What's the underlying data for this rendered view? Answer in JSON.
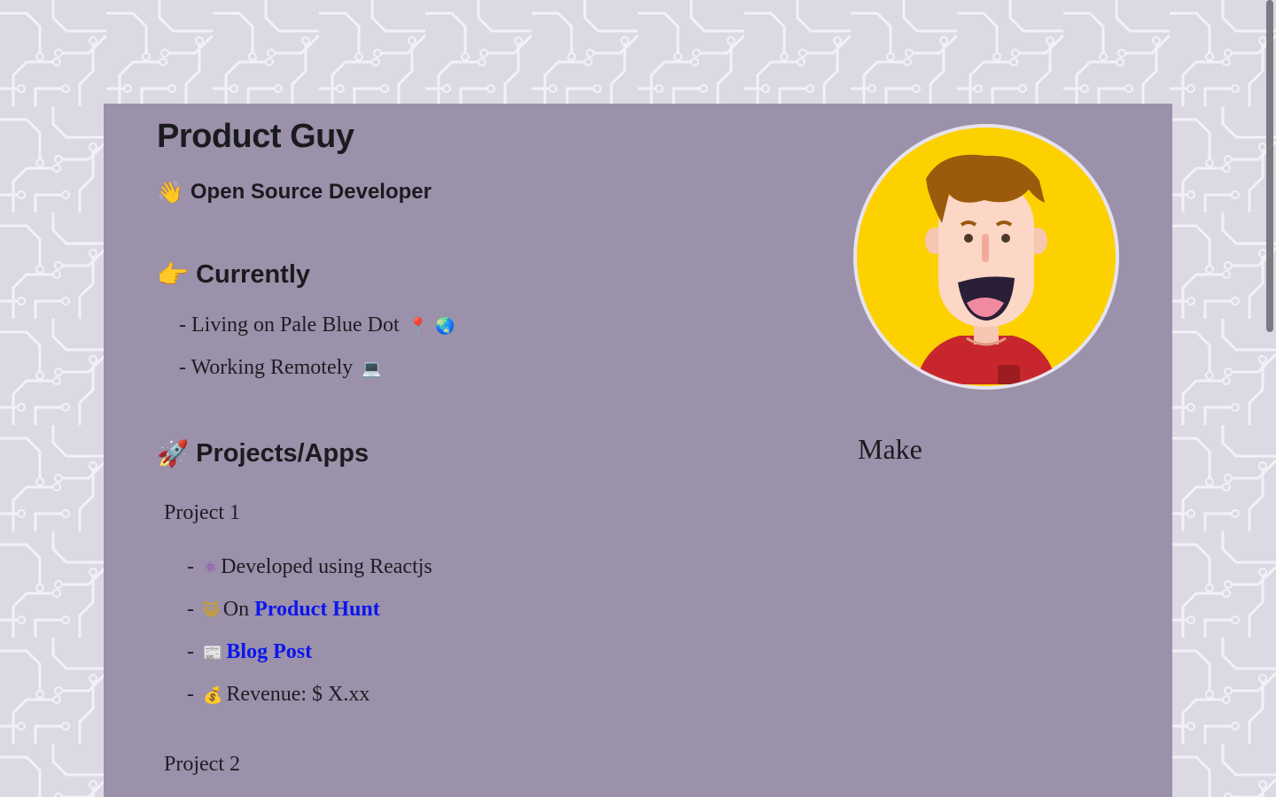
{
  "profile": {
    "name": "Product Guy",
    "subtitle_icon": "waving-hand-icon",
    "subtitle": "Open Source Developer"
  },
  "currently": {
    "icon": "pointing-hand-icon",
    "heading": "Currently",
    "items": [
      {
        "prefix": "- ",
        "text": "Living on Pale Blue Dot",
        "icons": [
          "pin-icon",
          "globe-icon"
        ]
      },
      {
        "prefix": "- ",
        "text": "Working Remotely",
        "icons": [
          "laptop-icon"
        ]
      }
    ]
  },
  "projects": {
    "icon": "rocket-icon",
    "heading": "Projects/Apps",
    "project1": {
      "title": "Project 1",
      "items": [
        {
          "prefix": "- ",
          "icon": "atom-icon",
          "text": "Developed using Reactjs"
        },
        {
          "prefix": "- ",
          "icon": "smiley-cat-icon",
          "text": "On ",
          "link": "Product Hunt"
        },
        {
          "prefix": "- ",
          "icon": "newspaper-icon",
          "link": "Blog Post"
        },
        {
          "prefix": "- ",
          "icon": "money-bag-icon",
          "text": "Revenue: $ X.xx"
        }
      ]
    },
    "project2": {
      "title": "Project 2"
    }
  },
  "sidebar": {
    "make_label": "Make"
  },
  "colors": {
    "page_bg": "#dcd9e4",
    "card_bg": "#9b91aa",
    "link": "#0b16ee",
    "avatar_bg": "#fdd000",
    "shirt": "#c8262d",
    "hair": "#9b5a0c"
  }
}
